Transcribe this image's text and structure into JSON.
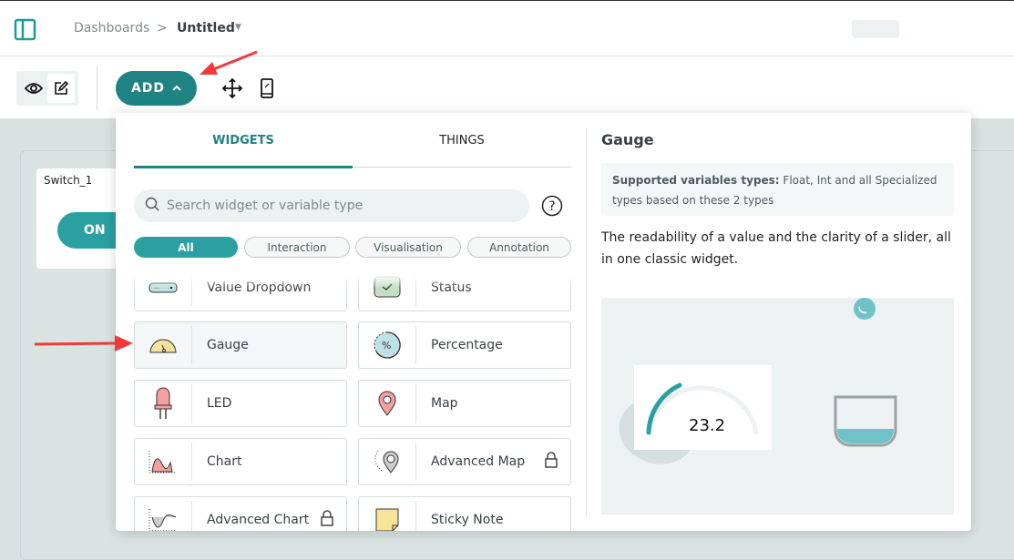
{
  "header": {
    "breadcrumb": {
      "parent": "Dashboards",
      "separator": ">",
      "current": "Untitled"
    },
    "icons": {
      "sidebar": "sidebar-toggle-icon",
      "dropdown": "caret-down-icon"
    }
  },
  "toolbar": {
    "add_label": "ADD",
    "icons": [
      "eye-icon",
      "edit-icon",
      "chevron-up-icon",
      "move-icon",
      "mobile-icon"
    ]
  },
  "dashboard": {
    "switch_widget": {
      "title": "Switch_1",
      "state": "ON"
    }
  },
  "popup": {
    "tabs": [
      {
        "label": "WIDGETS",
        "active": true
      },
      {
        "label": "THINGS",
        "active": false
      }
    ],
    "search": {
      "placeholder": "Search widget or variable type",
      "value": ""
    },
    "filters": [
      {
        "label": "All",
        "active": true
      },
      {
        "label": "Interaction"
      },
      {
        "label": "Visualisation"
      },
      {
        "label": "Annotation"
      }
    ],
    "widgets": [
      {
        "label": "Value Dropdown",
        "icon": "dropdown-icon",
        "locked": false
      },
      {
        "label": "Status",
        "icon": "status-icon",
        "locked": false
      },
      {
        "label": "Gauge",
        "icon": "gauge-icon",
        "locked": false,
        "selected": true
      },
      {
        "label": "Percentage",
        "icon": "percentage-icon",
        "locked": false
      },
      {
        "label": "LED",
        "icon": "led-icon",
        "locked": false
      },
      {
        "label": "Map",
        "icon": "map-pin-icon",
        "locked": false
      },
      {
        "label": "Chart",
        "icon": "chart-icon",
        "locked": false
      },
      {
        "label": "Advanced Map",
        "icon": "advanced-map-icon",
        "locked": true
      },
      {
        "label": "Advanced Chart",
        "icon": "advanced-chart-icon",
        "locked": true
      },
      {
        "label": "Sticky Note",
        "icon": "sticky-note-icon",
        "locked": false
      }
    ],
    "detail": {
      "title": "Gauge",
      "supported_label": "Supported variables types:",
      "supported_value": " Float, Int and all Specialized types based on these 2 types",
      "description": "The readability of a value and the clarity of a slider, all in one classic widget.",
      "preview_value": "23.2"
    }
  },
  "colors": {
    "accent": "#1f8383",
    "chip_active": "#2ba0a3",
    "annotation_arrow": "#f23a3a"
  }
}
